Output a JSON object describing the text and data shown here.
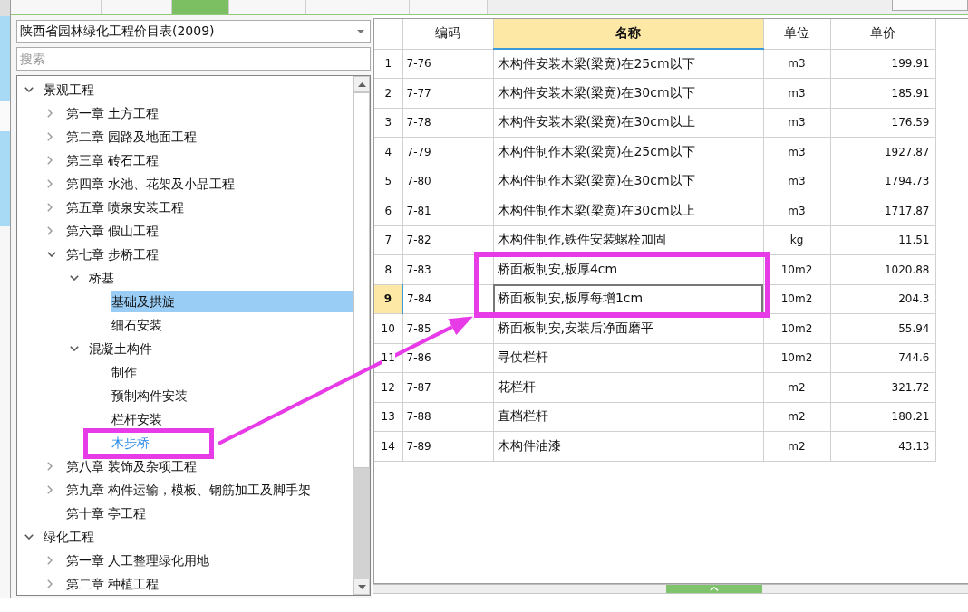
{
  "tabs": [
    {
      "selected": false
    },
    {
      "selected": false
    },
    {
      "selected": true
    },
    {
      "selected": false
    },
    {
      "selected": false
    },
    {
      "selected": false
    }
  ],
  "library_select": {
    "value": "陕西省园林绿化工程价目表(2009)"
  },
  "search": {
    "placeholder": "搜索"
  },
  "tree": [
    {
      "label": "景观工程",
      "expanded": true,
      "selected": false,
      "hovered": false,
      "children": [
        {
          "label": "第一章 土方工程",
          "expanded": false,
          "selected": false,
          "hovered": false
        },
        {
          "label": "第二章 园路及地面工程",
          "expanded": false,
          "selected": false,
          "hovered": false
        },
        {
          "label": "第三章 砖石工程",
          "expanded": false,
          "selected": false,
          "hovered": false
        },
        {
          "label": "第四章 水池、花架及小品工程",
          "expanded": false,
          "selected": false,
          "hovered": false
        },
        {
          "label": "第五章 喷泉安装工程",
          "expanded": false,
          "selected": false,
          "hovered": false
        },
        {
          "label": "第六章 假山工程",
          "expanded": false,
          "selected": false,
          "hovered": false
        },
        {
          "label": "第七章 步桥工程",
          "expanded": true,
          "selected": false,
          "hovered": false,
          "children": [
            {
              "label": "桥基",
              "expanded": true,
              "selected": false,
              "hovered": false,
              "children": [
                {
                  "label": "基础及拱旋",
                  "selected": true,
                  "hovered": false
                },
                {
                  "label": "细石安装",
                  "selected": false,
                  "hovered": false
                }
              ]
            },
            {
              "label": "混凝土构件",
              "expanded": true,
              "selected": false,
              "hovered": false,
              "children": [
                {
                  "label": "制作",
                  "selected": false,
                  "hovered": false
                },
                {
                  "label": "预制构件安装",
                  "selected": false,
                  "hovered": false
                },
                {
                  "label": "栏杆安装",
                  "selected": false,
                  "hovered": false
                },
                {
                  "label": "木步桥",
                  "selected": false,
                  "hovered": true
                }
              ]
            }
          ]
        },
        {
          "label": "第八章 装饰及杂项工程",
          "expanded": false,
          "selected": false,
          "hovered": false
        },
        {
          "label": "第九章 构件运输，模板、钢筋加工及脚手架",
          "expanded": false,
          "selected": false,
          "hovered": false
        },
        {
          "label": "第十章 亭工程",
          "selected": false,
          "hovered": false
        }
      ]
    },
    {
      "label": "绿化工程",
      "expanded": true,
      "selected": false,
      "hovered": false,
      "children": [
        {
          "label": "第一章 人工整理绿化用地",
          "expanded": false,
          "selected": false,
          "hovered": false
        },
        {
          "label": "第二章 种植工程",
          "expanded": false,
          "selected": false,
          "hovered": false
        }
      ]
    }
  ],
  "table": {
    "columns": [
      {
        "label": "编码",
        "selected": false
      },
      {
        "label": "名称",
        "selected": true
      },
      {
        "label": "单位",
        "selected": false
      },
      {
        "label": "单价",
        "selected": false
      }
    ],
    "rows": [
      {
        "number": "1",
        "selected": false,
        "cells": [
          "7-76",
          "木构件安装木梁(梁宽)在25cm以下",
          "m3",
          "199.91"
        ]
      },
      {
        "number": "2",
        "selected": false,
        "cells": [
          "7-77",
          "木构件安装木梁(梁宽)在30cm以下",
          "m3",
          "185.91"
        ]
      },
      {
        "number": "3",
        "selected": false,
        "cells": [
          "7-78",
          "木构件安装木梁(梁宽)在30cm以上",
          "m3",
          "176.59"
        ]
      },
      {
        "number": "4",
        "selected": false,
        "cells": [
          "7-79",
          "木构件制作木梁(梁宽)在25cm以下",
          "m3",
          "1927.87"
        ]
      },
      {
        "number": "5",
        "selected": false,
        "cells": [
          "7-80",
          "木构件制作木梁(梁宽)在30cm以下",
          "m3",
          "1794.73"
        ]
      },
      {
        "number": "6",
        "selected": false,
        "cells": [
          "7-81",
          "木构件制作木梁(梁宽)在30cm以上",
          "m3",
          "1717.87"
        ]
      },
      {
        "number": "7",
        "selected": false,
        "cells": [
          "7-82",
          "木构件制作,铁件安装螺栓加固",
          "kg",
          "11.51"
        ]
      },
      {
        "number": "8",
        "selected": false,
        "cells": [
          "7-83",
          "桥面板制安,板厚4cm",
          "10m2",
          "1020.88"
        ]
      },
      {
        "number": "9",
        "selected": true,
        "cells": [
          "7-84",
          "桥面板制安,板厚每增1cm",
          "10m2",
          "204.3"
        ]
      },
      {
        "number": "10",
        "selected": false,
        "cells": [
          "7-85",
          "桥面板制安,安装后净面磨平",
          "10m2",
          "55.94"
        ]
      },
      {
        "number": "11",
        "selected": false,
        "cells": [
          "7-86",
          "寻仗栏杆",
          "10m2",
          "744.6"
        ]
      },
      {
        "number": "12",
        "selected": false,
        "cells": [
          "7-87",
          "花栏杆",
          "m2",
          "321.72"
        ]
      },
      {
        "number": "13",
        "selected": false,
        "cells": [
          "7-88",
          "直档栏杆",
          "m2",
          "180.21"
        ]
      },
      {
        "number": "14",
        "selected": false,
        "cells": [
          "7-89",
          "木构件油漆",
          "m2",
          "43.13"
        ]
      }
    ]
  }
}
